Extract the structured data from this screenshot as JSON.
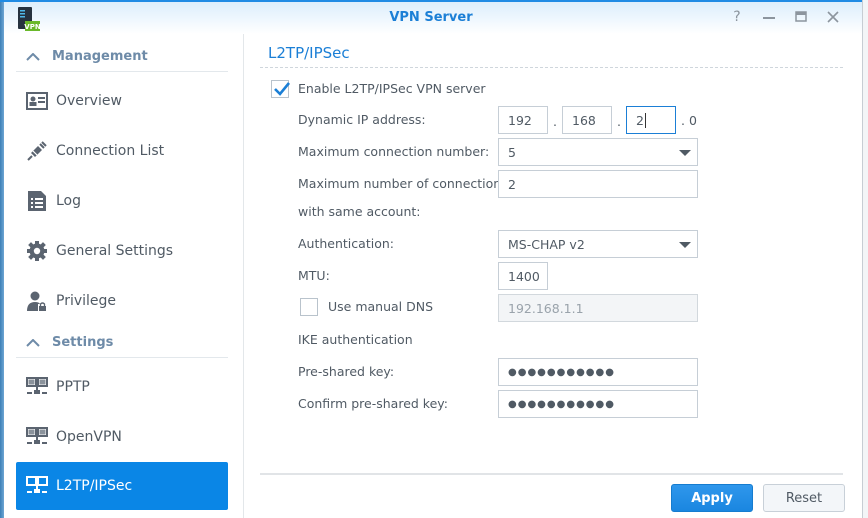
{
  "window": {
    "title": "VPN Server",
    "app_icon": "vpn-server-app-icon",
    "app_icon_badge": "VPN",
    "controls": [
      {
        "name": "help",
        "glyph": "?"
      },
      {
        "name": "minimize",
        "glyph": "—"
      },
      {
        "name": "maximize",
        "glyph": "▭"
      },
      {
        "name": "close",
        "glyph": "✕"
      }
    ]
  },
  "sidebar": {
    "sections": [
      {
        "label": "Management",
        "items": [
          {
            "label": "Overview",
            "icon": "overview-icon"
          },
          {
            "label": "Connection List",
            "icon": "plug-icon"
          },
          {
            "label": "Log",
            "icon": "log-icon"
          },
          {
            "label": "General Settings",
            "icon": "gear-icon"
          },
          {
            "label": "Privilege",
            "icon": "user-lock-icon"
          }
        ]
      },
      {
        "label": "Settings",
        "items": [
          {
            "label": "PPTP",
            "icon": "network-icon"
          },
          {
            "label": "OpenVPN",
            "icon": "network-icon"
          },
          {
            "label": "L2TP/IPSec",
            "icon": "network-icon",
            "active": true
          }
        ]
      }
    ]
  },
  "main": {
    "section_title": "L2TP/IPSec",
    "enable": {
      "label": "Enable L2TP/IPSec VPN server",
      "checked": true
    },
    "dynamic_ip": {
      "label": "Dynamic IP address:",
      "octets": [
        "192",
        "168",
        "2",
        "0"
      ],
      "separator": "."
    },
    "max_connections": {
      "label": "Maximum connection number:",
      "value": "5"
    },
    "max_same_account": {
      "label_line1": "Maximum number of connections",
      "label_line2": "with same account:",
      "value": "2"
    },
    "authentication": {
      "label": "Authentication:",
      "value": "MS-CHAP v2"
    },
    "mtu": {
      "label": "MTU:",
      "value": "1400"
    },
    "manual_dns": {
      "label": "Use manual DNS",
      "checked": false,
      "value": "192.168.1.1"
    },
    "ike_heading": "IKE authentication",
    "psk": {
      "label": "Pre-shared key:",
      "value": "●●●●●●●●●●●"
    },
    "psk_confirm": {
      "label": "Confirm pre-shared key:",
      "value": "●●●●●●●●●●●"
    },
    "buttons": {
      "apply": "Apply",
      "reset": "Reset"
    }
  },
  "colors": {
    "accent": "#1b7fd6",
    "active_item": "#0a86e6",
    "section_head": "#6e8ba8"
  }
}
